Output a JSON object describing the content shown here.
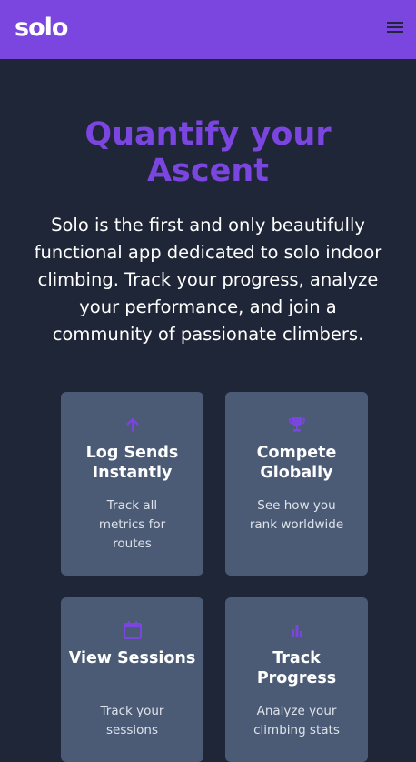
{
  "header": {
    "logo": "solo",
    "menu_icon": "hamburger-menu-icon"
  },
  "hero": {
    "title": "Quantify your Ascent",
    "description": "Solo is the first and only beautifully functional app dedicated to solo indoor climbing. Track your progress, analyze your performance, and join a community of passionate climbers."
  },
  "features": [
    {
      "icon": "arrow-up-icon",
      "title": "Log Sends Instantly",
      "description": "Track all metrics for routes"
    },
    {
      "icon": "trophy-icon",
      "title": "Compete Globally",
      "description": "See how you rank worldwide"
    },
    {
      "icon": "calendar-icon",
      "title": "View Sessions",
      "description": "Track your sessions"
    },
    {
      "icon": "bar-chart-icon",
      "title": "Track Progress",
      "description": "Analyze your climbing stats"
    }
  ],
  "colors": {
    "brand": "#7b45e0",
    "background": "#1f2637",
    "card": "#4b5b76",
    "text": "#ffffff"
  }
}
